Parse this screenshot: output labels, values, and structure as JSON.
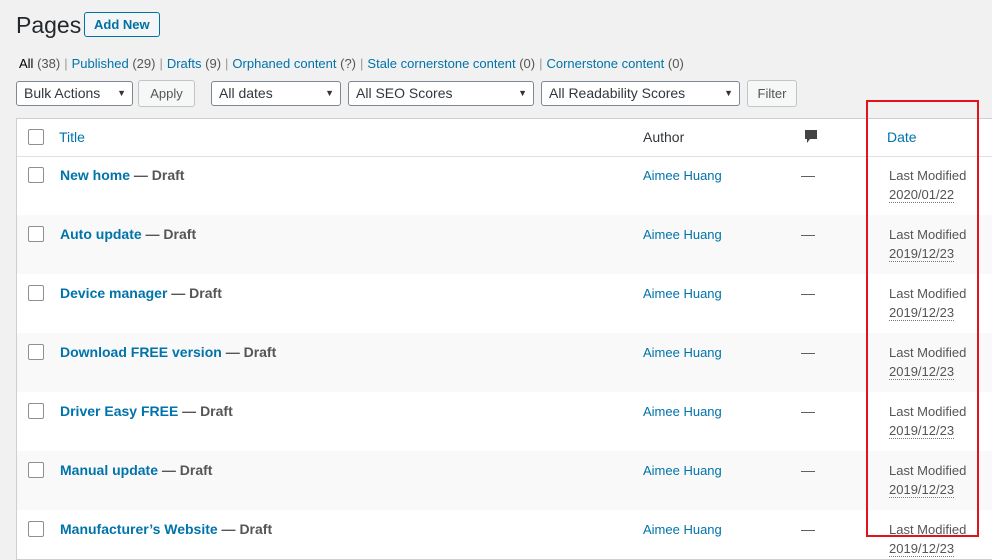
{
  "header": {
    "title": "Pages",
    "add_new": "Add New"
  },
  "views": [
    {
      "label": "All",
      "count": "(38)",
      "current": true
    },
    {
      "label": "Published",
      "count": "(29)"
    },
    {
      "label": "Drafts",
      "count": "(9)"
    },
    {
      "label": "Orphaned content",
      "count": "(?)"
    },
    {
      "label": "Stale cornerstone content",
      "count": "(0)"
    },
    {
      "label": "Cornerstone content",
      "count": "(0)"
    }
  ],
  "filters": {
    "bulk_actions": "Bulk Actions",
    "apply": "Apply",
    "dates": "All dates",
    "seo": "All SEO Scores",
    "readability": "All Readability Scores",
    "filter": "Filter"
  },
  "columns": {
    "title": "Title",
    "author": "Author",
    "date": "Date"
  },
  "rows": [
    {
      "title": "New home",
      "state": " — Draft",
      "author": "Aimee Huang",
      "comments": "—",
      "date_label": "Last Modified",
      "date": "2020/01/22"
    },
    {
      "title": "Auto update",
      "state": " — Draft",
      "author": "Aimee Huang",
      "comments": "—",
      "date_label": "Last Modified",
      "date": "2019/12/23"
    },
    {
      "title": "Device manager",
      "state": " — Draft",
      "author": "Aimee Huang",
      "comments": "—",
      "date_label": "Last Modified",
      "date": "2019/12/23"
    },
    {
      "title": "Download FREE version",
      "state": " — Draft",
      "author": "Aimee Huang",
      "comments": "—",
      "date_label": "Last Modified",
      "date": "2019/12/23"
    },
    {
      "title": "Driver Easy FREE",
      "state": " — Draft",
      "author": "Aimee Huang",
      "comments": "—",
      "date_label": "Last Modified",
      "date": "2019/12/23"
    },
    {
      "title": "Manual update",
      "state": " — Draft",
      "author": "Aimee Huang",
      "comments": "—",
      "date_label": "Last Modified",
      "date": "2019/12/23"
    },
    {
      "title": "Manufacturer’s Website",
      "state": " — Draft",
      "author": "Aimee Huang",
      "comments": "—",
      "date_label": "Last Modified",
      "date": "2019/12/23"
    }
  ],
  "icons": {
    "comments": "comment-bubble-icon",
    "dropdown": "chevron-down-icon"
  },
  "colors": {
    "link": "#0073aa",
    "highlight": "#e3131b"
  }
}
